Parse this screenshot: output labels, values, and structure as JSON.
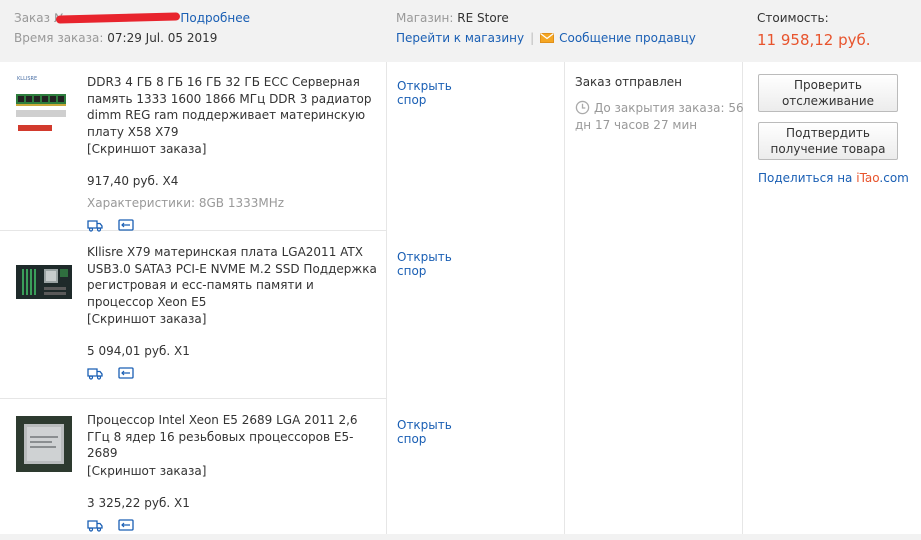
{
  "header": {
    "order_label": "Заказ №",
    "details_link": "Подробнее",
    "order_time_label": "Время заказа:",
    "order_time": "07:29 Jul. 05 2019",
    "store_label": "Магазин:",
    "store_name": "RE Store",
    "go_to_store": "Перейти к магазину",
    "separator": "|",
    "message_seller": "Сообщение продавцу",
    "cost_label": "Стоимость:",
    "cost_value": "11 958,12 руб."
  },
  "products": [
    {
      "title": "DDR3 4 ГБ 8 ГБ 16 ГБ 32 ГБ ECC Серверная память 1333 1600 1866 МГц DDR 3 радиатор dimm REG ram поддерживает материнскую плату X58 X79",
      "screenshot_link": "[Скриншот заказа]",
      "price": "917,40 руб. X4",
      "characteristics": "Характеристики: 8GB 1333MHz",
      "dispute": "Открыть спор",
      "thumb_brand": "KLLISRE"
    },
    {
      "title": "Kllisre X79 материнская плата LGA2011 ATX USB3.0 SATA3 PCI-E NVME M.2 SSD Поддержка регистровая и ecc-память памяти и процессор Xeon E5",
      "screenshot_link": "[Скриншот заказа]",
      "price": "5 094,01 руб. X1",
      "dispute": "Открыть спор"
    },
    {
      "title": "Процессор Intel Xeon E5 2689 LGA 2011 2,6 ГГц 8 ядер 16 резьбовых процессоров E5-2689",
      "screenshot_link": "[Скриншот заказа]",
      "price": "3 325,22 руб. X1",
      "dispute": "Открыть спор"
    }
  ],
  "status": {
    "title": "Заказ отправлен",
    "countdown": "До закрытия заказа: 56 дн 17 часов 27 мин"
  },
  "actions": {
    "check_tracking": "Проверить отслеживание",
    "confirm_receipt": "Подтвердить получение товара",
    "share_prefix": "Поделиться на ",
    "share_brand": "iTao",
    "share_suffix": ".com"
  },
  "colors": {
    "link": "#1a5fb4",
    "price_accent": "#e8542d",
    "header_bg": "#f2f2f2",
    "mail_icon": "#f5a623"
  },
  "icons": [
    "truck-icon",
    "receipt-icon",
    "mail-icon",
    "clock-icon"
  ]
}
